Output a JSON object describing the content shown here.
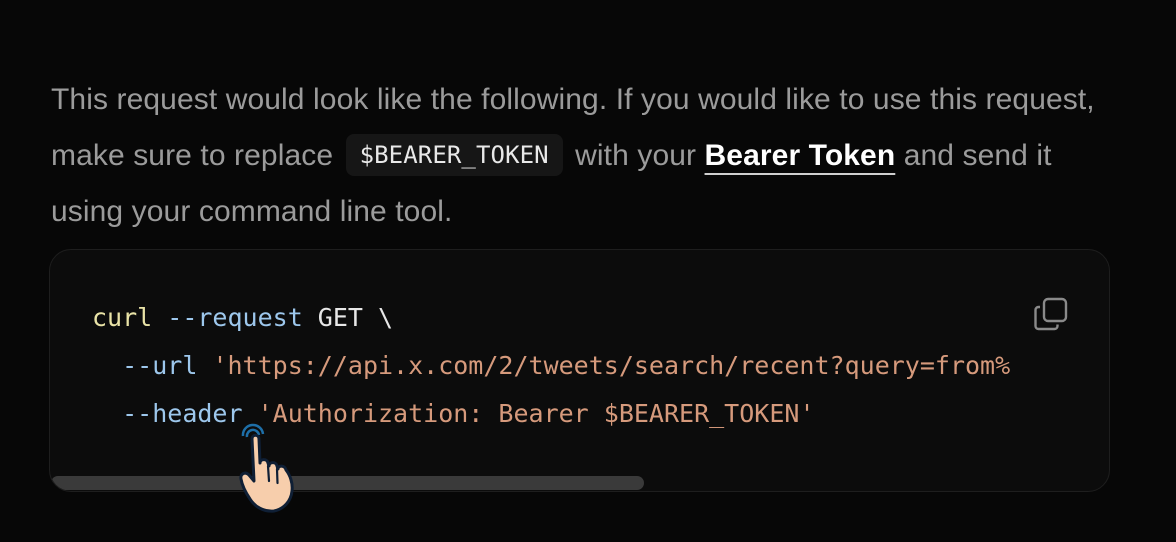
{
  "paragraph": {
    "text1": "This request would look like the following. If you would like to use this request, make sure to replace",
    "inline_code": "$BEARER_TOKEN",
    "text2": "with your",
    "link": "Bearer Token",
    "text3": "and send it using your command line tool."
  },
  "code_block": {
    "lines": [
      [
        {
          "text": "curl",
          "kind": "cmd"
        },
        {
          "text": " ",
          "kind": "plain"
        },
        {
          "text": "--request",
          "kind": "flag"
        },
        {
          "text": " GET \\",
          "kind": "plain"
        }
      ],
      [
        {
          "text": "  ",
          "kind": "plain"
        },
        {
          "text": "--url",
          "kind": "flag"
        },
        {
          "text": " ",
          "kind": "plain"
        },
        {
          "text": "'https://api.x.com/2/tweets/search/recent?query=from%",
          "kind": "str"
        }
      ],
      [
        {
          "text": "  ",
          "kind": "plain"
        },
        {
          "text": "--header",
          "kind": "flag"
        },
        {
          "text": " ",
          "kind": "plain"
        },
        {
          "text": "'Authorization: Bearer $BEARER_TOKEN'",
          "kind": "str"
        }
      ]
    ],
    "copy_icon": "copy-icon",
    "scroll_position_fraction": 0.56
  },
  "cursor": {
    "icon": "pointer-hand-icon"
  },
  "colors": {
    "background": "#070707",
    "text_muted": "#9b9b9b",
    "code_command": "#e9e3a7",
    "code_flag": "#9dc7ec",
    "code_string": "#d69a7c"
  }
}
